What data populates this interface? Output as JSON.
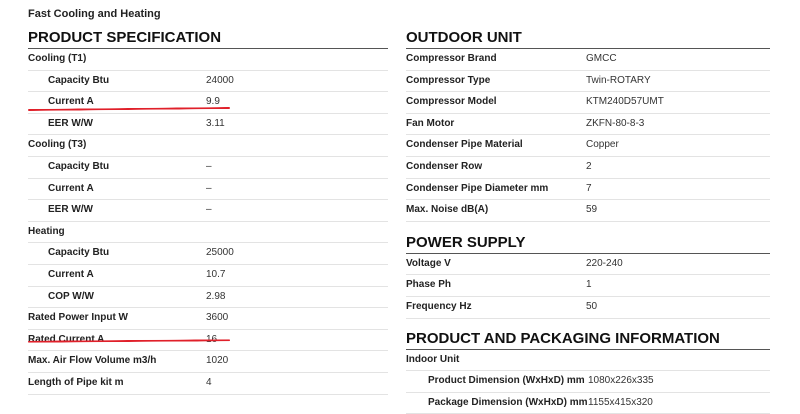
{
  "header": {
    "subtitle": "Fast Cooling and Heating"
  },
  "product_spec": {
    "title": "PRODUCT SPECIFICATION",
    "rows": [
      {
        "label": "Cooling (T1)",
        "value": ""
      },
      {
        "label": "Capacity   Btu",
        "value": "24000"
      },
      {
        "label": "Current   A",
        "value": "9.9"
      },
      {
        "label": "EER  W/W",
        "value": "3.11"
      },
      {
        "label": "Cooling (T3)",
        "value": ""
      },
      {
        "label": "Capacity   Btu",
        "value": "–"
      },
      {
        "label": "Current   A",
        "value": "–"
      },
      {
        "label": "EER  W/W",
        "value": "–"
      },
      {
        "label": "Heating",
        "value": ""
      },
      {
        "label": "Capacity   Btu",
        "value": "25000"
      },
      {
        "label": "Current   A",
        "value": "10.7"
      },
      {
        "label": "COP  W/W",
        "value": "2.98"
      },
      {
        "label": "Rated Power Input  W",
        "value": "3600"
      },
      {
        "label": "Rated Current   A",
        "value": "16"
      },
      {
        "label": "Max. Air Flow Volume   m3/h",
        "value": "1020"
      },
      {
        "label": "Length of Pipe kit   m",
        "value": "4"
      }
    ]
  },
  "outdoor_unit": {
    "title": "OUTDOOR UNIT",
    "rows": [
      {
        "label": "Compressor Brand",
        "value": "GMCC"
      },
      {
        "label": "Compressor Type",
        "value": "Twin-ROTARY"
      },
      {
        "label": "Compressor Model",
        "value": "KTM240D57UMT"
      },
      {
        "label": "Fan Motor",
        "value": "ZKFN-80-8-3"
      },
      {
        "label": "Condenser Pipe Material",
        "value": "Copper"
      },
      {
        "label": "Condenser Row",
        "value": "2"
      },
      {
        "label": "Condenser Pipe Diameter   mm",
        "value": "7"
      },
      {
        "label": "Max. Noise   dB(A)",
        "value": "59"
      }
    ]
  },
  "power_supply": {
    "title": "POWER SUPPLY",
    "rows": [
      {
        "label": "Voltage  V",
        "value": "220-240"
      },
      {
        "label": "Phase   Ph",
        "value": "1"
      },
      {
        "label": "Frequency   Hz",
        "value": "50"
      }
    ]
  },
  "packaging": {
    "title": "PRODUCT AND PACKAGING INFORMATION",
    "rows": [
      {
        "label": "Indoor Unit",
        "value": ""
      },
      {
        "label": "Product Dimension (WxHxD)   mm",
        "value": "1080x226x335"
      },
      {
        "label": "Package Dimension (WxHxD)   mm",
        "value": "1155x415x320"
      }
    ]
  },
  "annotation_color": "#e0202a"
}
